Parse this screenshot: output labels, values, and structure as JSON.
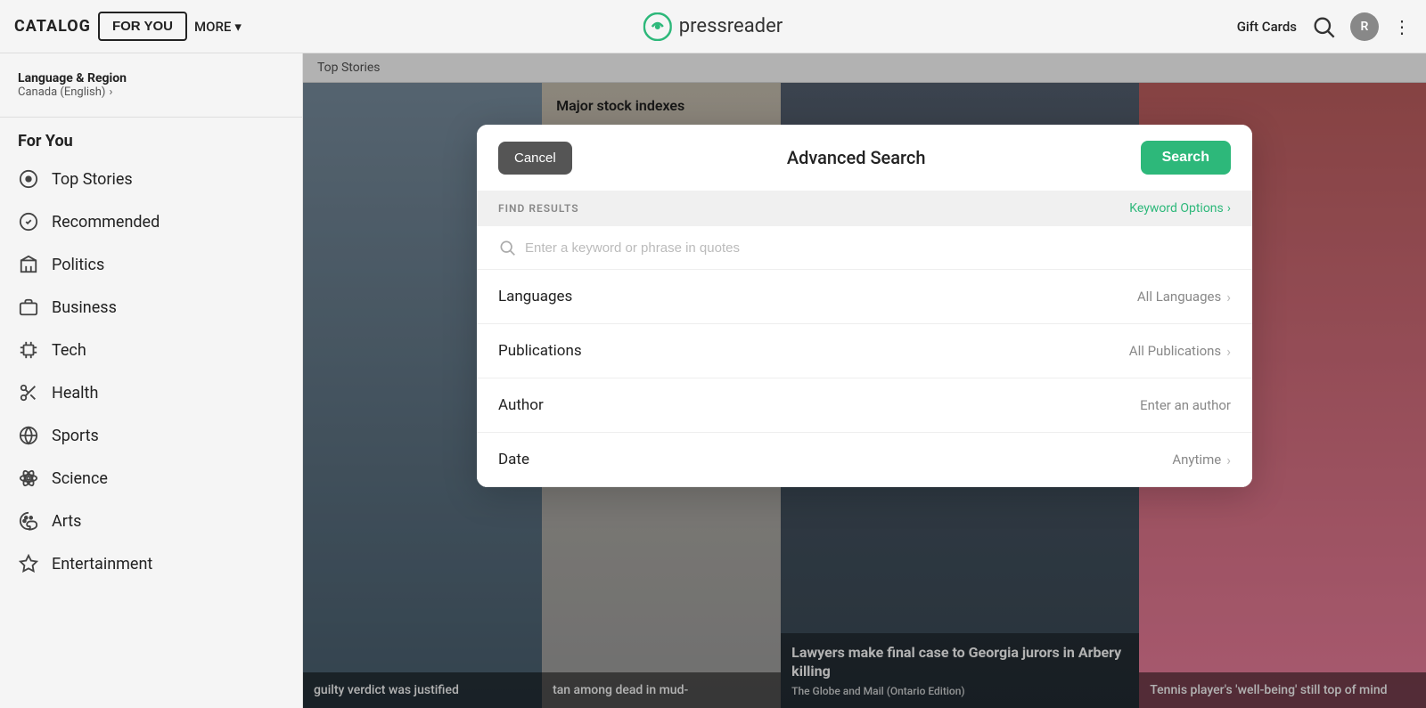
{
  "nav": {
    "catalog": "CATALOG",
    "for_you": "FOR YOU",
    "more": "MORE",
    "gift_cards": "Gift Cards",
    "avatar_letter": "R"
  },
  "logo": {
    "text": "pressreader"
  },
  "sidebar": {
    "lang_region_title": "Language & Region",
    "lang_region_sub": "Canada (English)",
    "section_title": "For You",
    "items": [
      {
        "label": "Top Stories",
        "icon": "circle-dot"
      },
      {
        "label": "Recommended",
        "icon": "check-circle"
      },
      {
        "label": "Politics",
        "icon": "building"
      },
      {
        "label": "Business",
        "icon": "briefcase"
      },
      {
        "label": "Tech",
        "icon": "cpu"
      },
      {
        "label": "Health",
        "icon": "scissors"
      },
      {
        "label": "Sports",
        "icon": "globe"
      },
      {
        "label": "Science",
        "icon": "atom"
      },
      {
        "label": "Arts",
        "icon": "palette"
      },
      {
        "label": "Entertainment",
        "icon": "star"
      }
    ]
  },
  "content": {
    "top_stories_label": "Top Stories",
    "article1": {
      "overlay_text": "guilty verdict was justified"
    },
    "article2": {
      "title": "Major stock indexes",
      "overlay_text": "tan among dead in mud-"
    },
    "article3": {
      "title": "Lawyers make final case to Georgia jurors in Arbery killing",
      "source": "The Globe and Mail (Ontario Edition)",
      "overlay_text": "Tennis player's 'well-being' still top of mind"
    }
  },
  "modal": {
    "title": "Advanced Search",
    "cancel_label": "Cancel",
    "search_label": "Search",
    "find_results_label": "FIND RESULTS",
    "keyword_options_label": "Keyword Options",
    "search_placeholder": "Enter a keyword or phrase in quotes",
    "filters": [
      {
        "label": "Languages",
        "value": "All Languages"
      },
      {
        "label": "Publications",
        "value": "All Publications"
      },
      {
        "label": "Author",
        "value": "Enter an author"
      },
      {
        "label": "Date",
        "value": "Anytime"
      }
    ]
  }
}
